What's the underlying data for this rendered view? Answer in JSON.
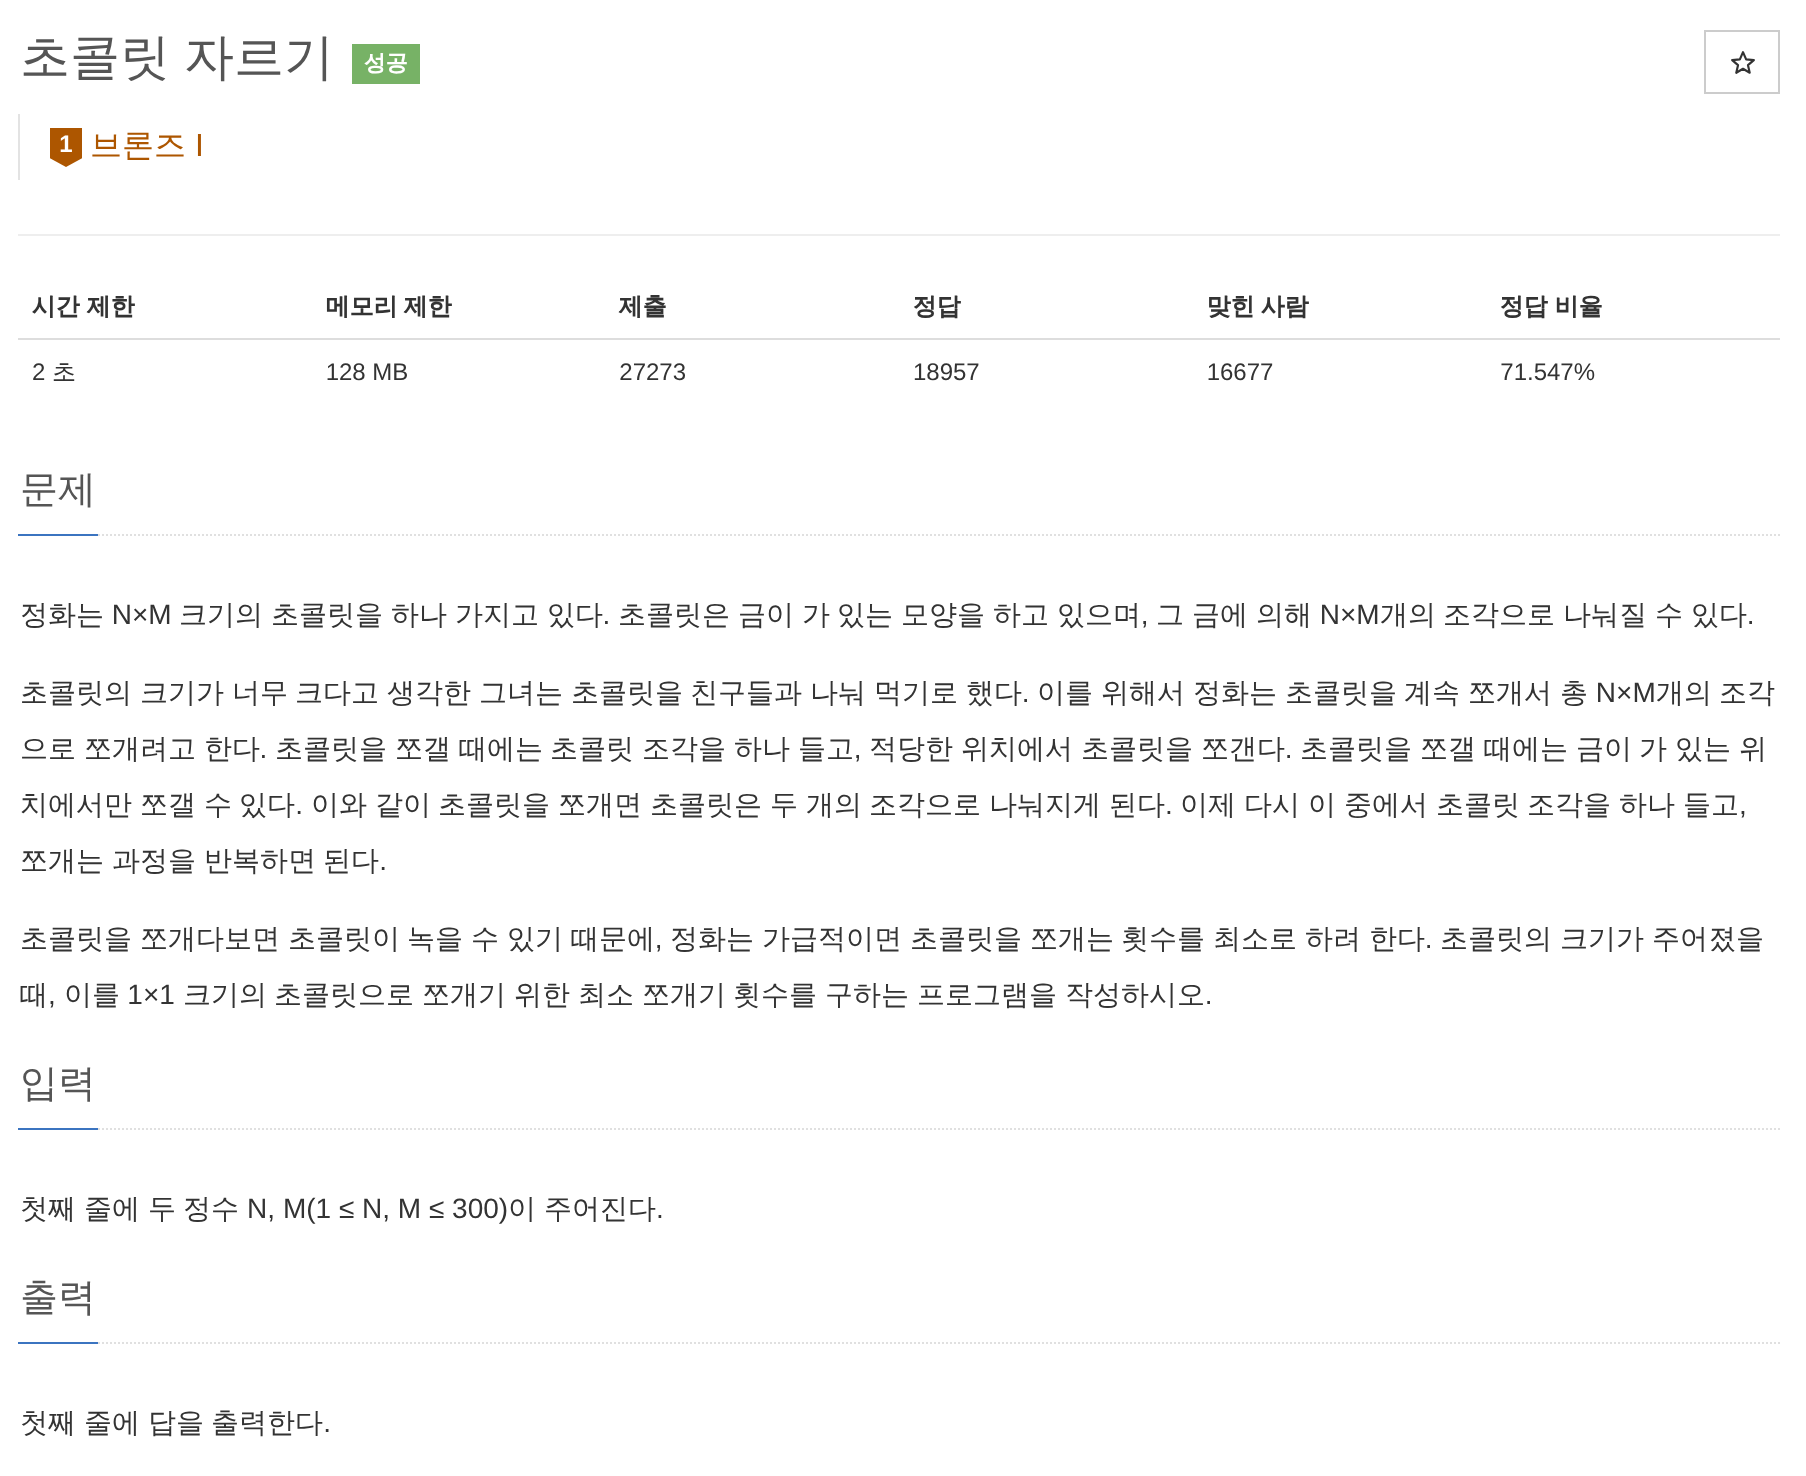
{
  "problem": {
    "title": "초콜릿 자르기",
    "result_badge": "성공",
    "favorited": false
  },
  "tier": {
    "number": "1",
    "name": "브론즈 I"
  },
  "stats_table": {
    "columns": [
      "시간 제한",
      "메모리 제한",
      "제출",
      "정답",
      "맞힌 사람",
      "정답 비율"
    ],
    "rows": [
      [
        "2 초",
        "128 MB",
        "27273",
        "18957",
        "16677",
        "71.547%"
      ]
    ]
  },
  "sections": [
    {
      "heading": "문제",
      "paragraphs": [
        "정화는 N×M 크기의 초콜릿을 하나 가지고 있다. 초콜릿은 금이 가 있는 모양을 하고 있으며, 그 금에 의해 N×M개의 조각으로 나눠질 수 있다.",
        "초콜릿의 크기가 너무 크다고 생각한 그녀는 초콜릿을 친구들과 나눠 먹기로 했다. 이를 위해서 정화는 초콜릿을 계속 쪼개서 총 N×M개의 조각으로 쪼개려고 한다. 초콜릿을 쪼갤 때에는 초콜릿 조각을 하나 들고, 적당한 위치에서 초콜릿을 쪼갠다. 초콜릿을 쪼갤 때에는 금이 가 있는 위치에서만 쪼갤 수 있다. 이와 같이 초콜릿을 쪼개면 초콜릿은 두 개의 조각으로 나눠지게 된다. 이제 다시 이 중에서 초콜릿 조각을 하나 들고, 쪼개는 과정을 반복하면 된다.",
        "초콜릿을 쪼개다보면 초콜릿이 녹을 수 있기 때문에, 정화는 가급적이면 초콜릿을 쪼개는 횟수를 최소로 하려 한다. 초콜릿의 크기가 주어졌을 때, 이를 1×1 크기의 초콜릿으로 쪼개기 위한 최소 쪼개기 횟수를 구하는 프로그램을 작성하시오."
      ]
    },
    {
      "heading": "입력",
      "paragraphs": [
        "첫째 줄에 두 정수 N, M(1 ≤ N, M ≤ 300)이 주어진다."
      ]
    },
    {
      "heading": "출력",
      "paragraphs": [
        "첫째 줄에 답을 출력한다."
      ]
    }
  ]
}
